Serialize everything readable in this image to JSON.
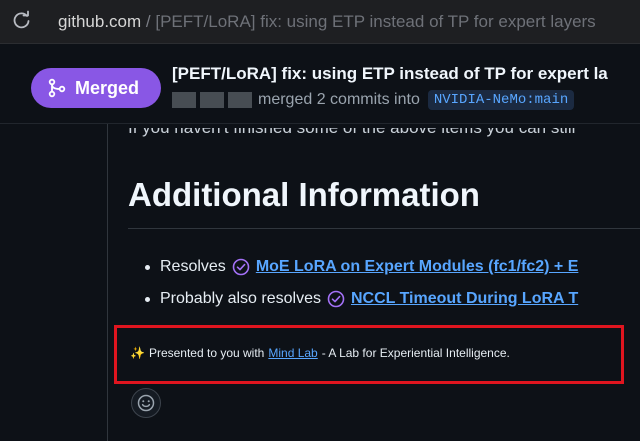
{
  "browser": {
    "domain": "github.com",
    "separator": "/",
    "path": "[PEFT/LoRA] fix: using ETP instead of TP for expert layers"
  },
  "header": {
    "status_badge": "Merged",
    "title": "[PEFT/LoRA] fix: using ETP instead of TP for expert la",
    "merged_text": "merged 2 commits into",
    "target_branch": "NVIDIA-NeMo:main"
  },
  "content": {
    "partial_line": "If you haven't finished some of the above items you can still",
    "heading": "Additional Information",
    "bullets": [
      {
        "label": "Resolves",
        "link": "MoE LoRA on Expert Modules (fc1/fc2) + E"
      },
      {
        "label": "Probably also resolves",
        "link": "NCCL Timeout During LoRA T"
      }
    ],
    "note": {
      "sparkle": "✨",
      "prefix": "Presented to you with",
      "link": "Mind Lab",
      "suffix": "- A Lab for Experiential Intelligence."
    }
  },
  "colors": {
    "merged_purple": "#8957e5",
    "link_blue": "#58a6ff",
    "highlight_red": "#e0151f",
    "background": "#0d1117"
  }
}
